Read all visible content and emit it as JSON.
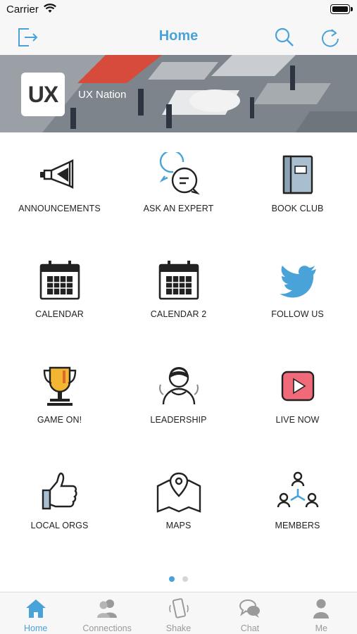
{
  "status_bar": {
    "carrier": "Carrier"
  },
  "nav": {
    "title": "Home"
  },
  "banner": {
    "logo_text": "UX",
    "org_name": "UX Nation"
  },
  "grid": {
    "items": [
      {
        "label": "ANNOUNCEMENTS",
        "icon": "megaphone-icon"
      },
      {
        "label": "ASK AN EXPERT",
        "icon": "chat-bubbles-icon"
      },
      {
        "label": "BOOK CLUB",
        "icon": "book-icon"
      },
      {
        "label": "CALENDAR",
        "icon": "calendar-icon"
      },
      {
        "label": "CALENDAR 2",
        "icon": "calendar-icon"
      },
      {
        "label": "FOLLOW US",
        "icon": "twitter-bird-icon"
      },
      {
        "label": "GAME ON!",
        "icon": "trophy-icon"
      },
      {
        "label": "LEADERSHIP",
        "icon": "leader-person-icon"
      },
      {
        "label": "LIVE NOW",
        "icon": "video-play-icon"
      },
      {
        "label": "LOCAL ORGS",
        "icon": "thumbs-up-icon"
      },
      {
        "label": "MAPS",
        "icon": "map-pin-icon"
      },
      {
        "label": "MEMBERS",
        "icon": "members-network-icon"
      }
    ]
  },
  "pager": {
    "page": 1,
    "pages": 2
  },
  "tabs": [
    {
      "label": "Home",
      "icon": "home-icon",
      "active": true
    },
    {
      "label": "Connections",
      "icon": "people-icon",
      "active": false
    },
    {
      "label": "Shake",
      "icon": "phone-shake-icon",
      "active": false
    },
    {
      "label": "Chat",
      "icon": "chat-icon",
      "active": false
    },
    {
      "label": "Me",
      "icon": "person-icon",
      "active": false
    }
  ],
  "colors": {
    "accent": "#4aa3d8",
    "tab_inactive": "#9a9a9a",
    "bar_bg": "#f7f7f7"
  }
}
